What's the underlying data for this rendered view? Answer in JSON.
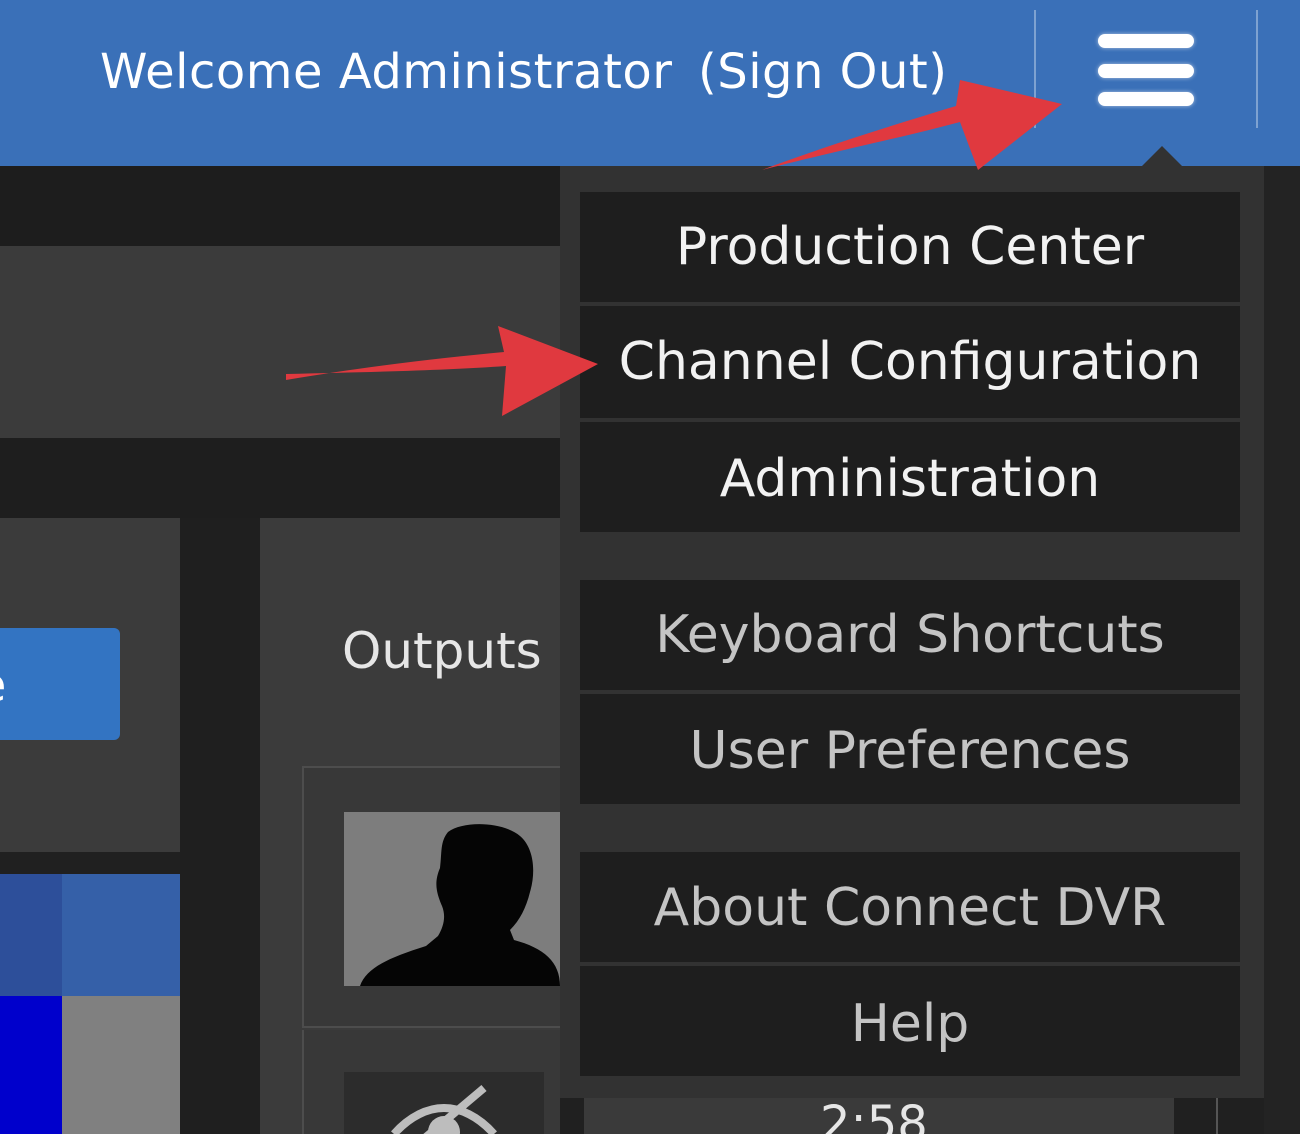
{
  "header": {
    "welcome_text": "Welcome Administrator",
    "sign_out_label": "(Sign Out)",
    "menu_icon": "hamburger-menu-icon",
    "background_color": "#3a70b8"
  },
  "menu": {
    "items": [
      {
        "label": "Production Center"
      },
      {
        "label": "Channel Configuration"
      },
      {
        "label": "Administration"
      },
      {
        "label": "Keyboard Shortcuts"
      },
      {
        "label": "User Preferences"
      },
      {
        "label": "About Connect DVR"
      },
      {
        "label": "Help"
      }
    ]
  },
  "background": {
    "outputs_title": "Outputs",
    "left_button_partial": "e",
    "timer_partial": "2:58",
    "eye_icon": "eye-slash-icon",
    "thumbnail_icon": "person-silhouette-icon"
  },
  "annotations": {
    "arrow_color": "#e0393f"
  }
}
